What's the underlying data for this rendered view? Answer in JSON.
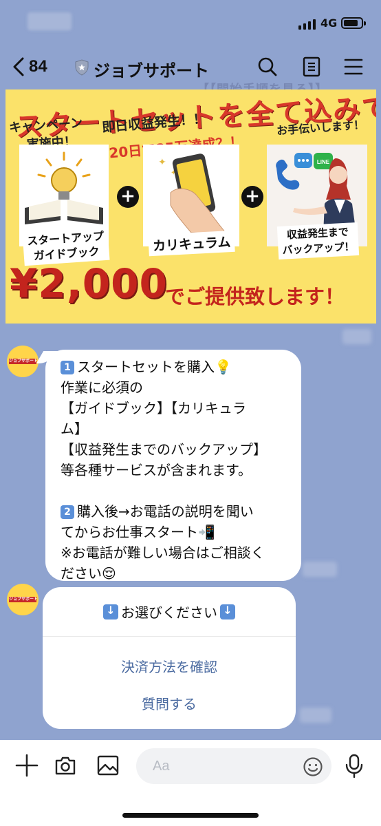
{
  "status_bar": {
    "network": "4G"
  },
  "header": {
    "back_count": "84",
    "title": "ジョブサポート",
    "ghost_text": "【【開始手順を見る】】"
  },
  "banner": {
    "headline": "スタートセットを全て込みで！！",
    "campaign_1": "キャンペーン",
    "campaign_2": "実施中！",
    "same_day": "即日収益発生！！",
    "eighty": "20日で85万達成？！",
    "assist": "お手伝いします！",
    "caption_guide_1": "スタートアップ",
    "caption_guide_2": "ガイドブック",
    "caption_curriculum": "カリキュラム",
    "caption_backup_1": "収益発生まで",
    "caption_backup_2": "バックアップ！",
    "price": "¥2,000",
    "price_tail": "でご提供致します！",
    "plus": "+",
    "line_badge": "LINE"
  },
  "avatar": {
    "label": "ジョブサポート"
  },
  "message": {
    "n1": "1",
    "l1": "スタートセットを購入💡",
    "l2": "作業に必須の",
    "l3": "【ガイドブック】【カリキュラ",
    "l4": "ム】",
    "l5": "【収益発生までのバックアップ】",
    "l6": "等各種サービスが含まれます。",
    "n2": "2",
    "l7": "購入後→お電話の説明を聞い",
    "l8": "てからお仕事スタート📲",
    "l9": "※お電話が難しい場合はご相談く",
    "l10": "ださい😌"
  },
  "options": {
    "title": "お選びください",
    "option_1": "決済方法を確認",
    "option_2": "質問する"
  },
  "input_bar": {
    "placeholder": "Aa"
  },
  "colors": {
    "chat_bg": "#8fa3cf",
    "banner_bg": "#fbe26a",
    "banner_red": "#d8372a",
    "option_link": "#4a6aa0",
    "keycap_blue": "#5a8fd8"
  }
}
